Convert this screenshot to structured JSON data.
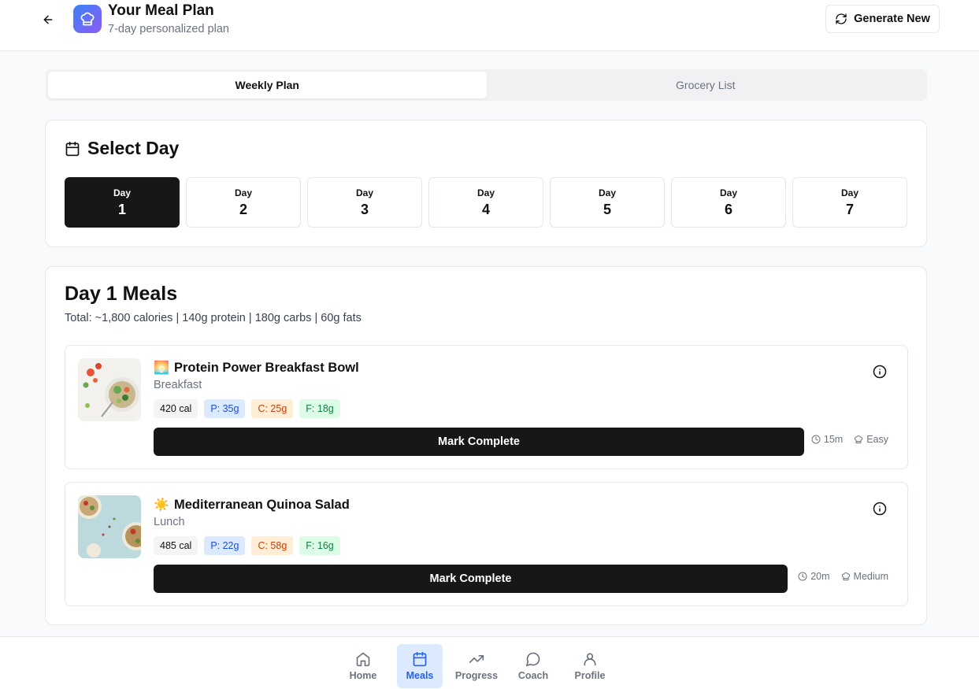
{
  "header": {
    "title": "Your Meal Plan",
    "subtitle": "7-day personalized plan",
    "generate_label": "Generate New",
    "back_icon": "arrow-left-icon",
    "logo_icon": "chef-hat-icon",
    "logo_gradient": [
      "#3b82f6",
      "#8b5cf6"
    ]
  },
  "tabs": [
    {
      "label": "Weekly Plan",
      "active": true
    },
    {
      "label": "Grocery List",
      "active": false
    }
  ],
  "select_day": {
    "title": "Select Day",
    "icon": "calendar-icon",
    "days": [
      {
        "label": "Day",
        "number": "1",
        "active": true
      },
      {
        "label": "Day",
        "number": "2",
        "active": false
      },
      {
        "label": "Day",
        "number": "3",
        "active": false
      },
      {
        "label": "Day",
        "number": "4",
        "active": false
      },
      {
        "label": "Day",
        "number": "5",
        "active": false
      },
      {
        "label": "Day",
        "number": "6",
        "active": false
      },
      {
        "label": "Day",
        "number": "7",
        "active": false
      }
    ]
  },
  "meals_section": {
    "title": "Day 1 Meals",
    "total": "Total: ~1,800 calories | 140g protein | 180g carbs | 60g fats",
    "meals": [
      {
        "emoji": "🌅",
        "name": "Protein Power Breakfast Bowl",
        "type": "Breakfast",
        "calories": "420 cal",
        "protein": "P: 35g",
        "carbs": "C: 25g",
        "fats": "F: 18g",
        "button_label": "Mark Complete",
        "time": "15m",
        "difficulty": "Easy"
      },
      {
        "emoji": "☀️",
        "name": "Mediterranean Quinoa Salad",
        "type": "Lunch",
        "calories": "485 cal",
        "protein": "P: 22g",
        "carbs": "C: 58g",
        "fats": "F: 16g",
        "button_label": "Mark Complete",
        "time": "20m",
        "difficulty": "Medium"
      }
    ]
  },
  "bottom_nav": [
    {
      "label": "Home",
      "icon": "home-icon",
      "active": false
    },
    {
      "label": "Meals",
      "icon": "calendar-icon",
      "active": true
    },
    {
      "label": "Progress",
      "icon": "trending-up-icon",
      "active": false
    },
    {
      "label": "Coach",
      "icon": "chat-bubble-icon",
      "active": false
    },
    {
      "label": "Profile",
      "icon": "user-icon",
      "active": false
    }
  ],
  "colors": {
    "accent": "#2563eb",
    "accent_bg": "#dbeafe",
    "primary_button": "#171717",
    "protein_bg": "#dbeafe",
    "carbs_bg": "#ffedd5",
    "fats_bg": "#dcfce7"
  }
}
